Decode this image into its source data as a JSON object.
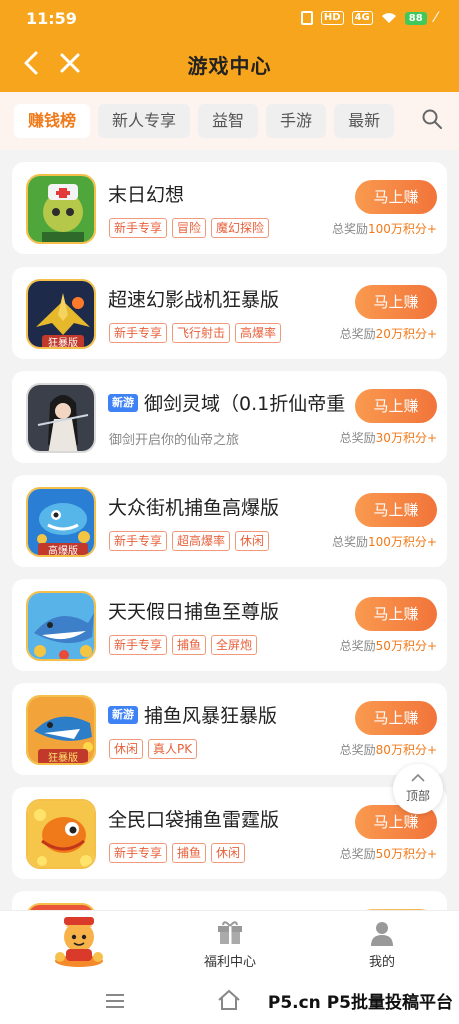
{
  "status_bar": {
    "time": "11:59",
    "network_hd": "HD",
    "network_4g": "4G",
    "battery": "88"
  },
  "nav": {
    "title": "游戏中心"
  },
  "tabs": [
    {
      "label": "赚钱榜",
      "active": true
    },
    {
      "label": "新人专享",
      "active": false
    },
    {
      "label": "益智",
      "active": false
    },
    {
      "label": "手游",
      "active": false
    },
    {
      "label": "最新",
      "active": false
    }
  ],
  "games": [
    {
      "name": "末日幻想",
      "new": false,
      "tags": [
        "新手专享",
        "冒险",
        "魔幻探险"
      ],
      "button": "马上赚",
      "reward_prefix": "总奖励",
      "reward_amount": "100万积分+"
    },
    {
      "name": "超速幻影战机狂暴版",
      "new": false,
      "tags": [
        "新手专享",
        "飞行射击",
        "高爆率"
      ],
      "button": "马上赚",
      "reward_prefix": "总奖励",
      "reward_amount": "20万积分+"
    },
    {
      "name": "御剑灵域（0.1折仙帝重",
      "new": true,
      "new_label": "新游",
      "description": "御剑开启你的仙帝之旅",
      "button": "马上赚",
      "reward_prefix": "总奖励",
      "reward_amount": "30万积分+"
    },
    {
      "name": "大众街机捕鱼高爆版",
      "new": false,
      "tags": [
        "新手专享",
        "超高爆率",
        "休闲"
      ],
      "button": "马上赚",
      "reward_prefix": "总奖励",
      "reward_amount": "100万积分+"
    },
    {
      "name": "天天假日捕鱼至尊版",
      "new": false,
      "tags": [
        "新手专享",
        "捕鱼",
        "全屏炮"
      ],
      "button": "马上赚",
      "reward_prefix": "总奖励",
      "reward_amount": "50万积分+"
    },
    {
      "name": "捕鱼风暴狂暴版",
      "new": true,
      "new_label": "新游",
      "tags": [
        "休闲",
        "真人PK"
      ],
      "button": "马上赚",
      "reward_prefix": "总奖励",
      "reward_amount": "80万积分+"
    },
    {
      "name": "全民口袋捕鱼雷霆版",
      "new": false,
      "tags": [
        "新手专享",
        "捕鱼",
        "休闲"
      ],
      "button": "马上赚",
      "reward_prefix": "总奖励",
      "reward_amount": "50万积分+"
    }
  ],
  "icon_labels": {
    "g2": "狂暴版",
    "g4": "高爆版",
    "g6": "狂暴版"
  },
  "back_to_top": {
    "label": "顶部"
  },
  "bottom_nav": {
    "welfare": "福利中心",
    "mine": "我的"
  },
  "watermark": "P5.cn P5批量投稿平台",
  "colors": {
    "header": "#f7a51c",
    "accent": "#f07a1a",
    "button": "#f2743a",
    "new_tag": "#3e82f5"
  }
}
